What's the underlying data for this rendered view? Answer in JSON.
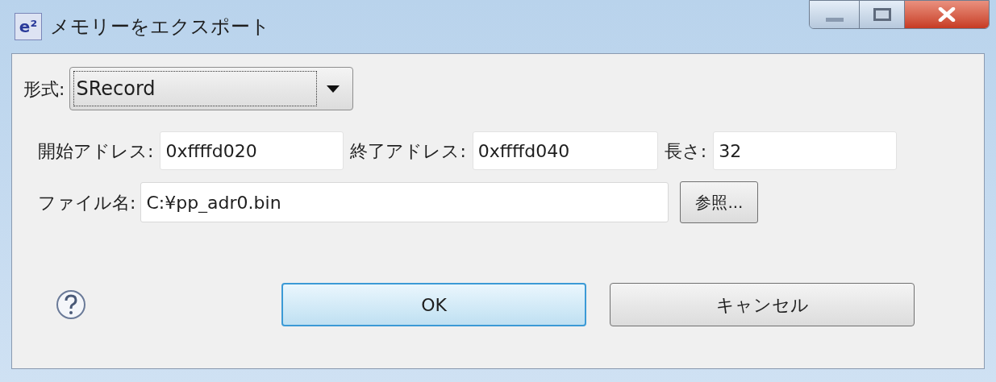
{
  "window": {
    "icon_text": "e²",
    "title": "メモリーをエクスポート"
  },
  "format": {
    "label": "形式:",
    "value": "SRecord"
  },
  "fields": [
    {
      "label": "開始アドレス:",
      "value": "0xffffd020"
    },
    {
      "label": "終了アドレス:",
      "value": "0xffffd040"
    },
    {
      "label": "長さ:",
      "value": "32"
    }
  ],
  "file": {
    "label": "ファイル名:",
    "value": "C:¥pp_adr0.bin",
    "browse": "参照..."
  },
  "buttons": [
    {
      "label": "OK",
      "default": true
    },
    {
      "label": "キャンセル",
      "default": false
    }
  ]
}
